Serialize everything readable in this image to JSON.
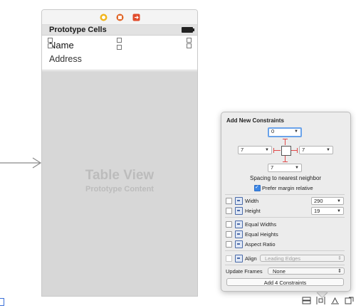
{
  "canvas": {
    "prototype_header": "Prototype Cells",
    "cell": {
      "title": "Name",
      "subtitle": "Address"
    },
    "table_view": {
      "title": "Table View",
      "subtitle": "Prototype Content"
    },
    "dock_icons": [
      "view-controller-icon",
      "first-responder-icon",
      "exit-icon"
    ],
    "bottom_toolbar_icons": [
      "stack-icon",
      "align-icon",
      "pin-icon",
      "resolve-issues-icon"
    ]
  },
  "popover": {
    "title": "Add New Constraints",
    "spacing": {
      "top": "0",
      "left": "7",
      "right": "7",
      "bottom": "7"
    },
    "spacing_caption": "Spacing to nearest neighbor",
    "prefer_margin": {
      "label": "Prefer margin relative",
      "checked": true
    },
    "width": {
      "label": "Width",
      "value": "290",
      "checked": false
    },
    "height": {
      "label": "Height",
      "value": "19",
      "checked": false
    },
    "equal_widths": "Equal Widths",
    "equal_heights": "Equal Heights",
    "aspect_ratio": "Aspect Ratio",
    "align": {
      "label": "Align",
      "value": "Leading Edges"
    },
    "update_frames": {
      "label": "Update Frames",
      "value": "None"
    },
    "add_button": "Add 4 Constraints"
  },
  "colors": {
    "accent": "#3b86e5",
    "strut": "#e04a4a",
    "table_bg": "#d7d7d7"
  }
}
